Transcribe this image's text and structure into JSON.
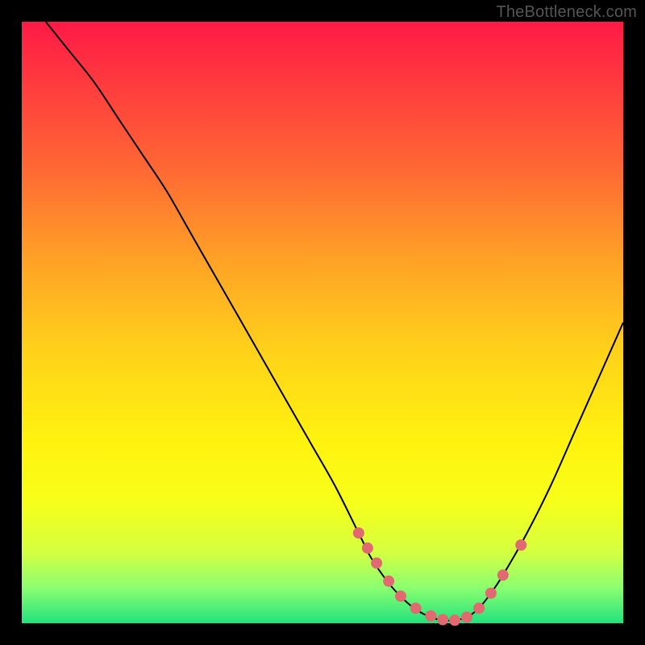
{
  "attribution": "TheBottleneck.com",
  "colors": {
    "background": "#000000",
    "gradient_top": "#ff1a46",
    "gradient_bottom": "#22e27e",
    "curve": "#000000",
    "marker": "#e06a6f"
  },
  "chart_data": {
    "type": "line",
    "title": "",
    "xlabel": "",
    "ylabel": "",
    "xlim": [
      0,
      100
    ],
    "ylim": [
      0,
      100
    ],
    "series": [
      {
        "name": "curve",
        "x": [
          4,
          8,
          12,
          16,
          20,
          24,
          28,
          32,
          36,
          40,
          44,
          48,
          52,
          56,
          57,
          58,
          60,
          62,
          64,
          66,
          68,
          70,
          72,
          74,
          76,
          78,
          80,
          84,
          88,
          92,
          96,
          100
        ],
        "y": [
          100,
          95,
          90,
          84,
          78,
          72,
          65,
          58,
          51,
          44,
          37,
          30,
          23,
          15,
          13,
          11,
          8,
          5.5,
          3.5,
          2,
          1,
          0.5,
          0.5,
          1,
          2.5,
          5,
          8,
          15,
          23,
          32,
          41,
          50
        ]
      }
    ],
    "markers": {
      "name": "highlight-points",
      "x": [
        56,
        57.5,
        59,
        61,
        63,
        65.5,
        68,
        70,
        72,
        74,
        76,
        78,
        80,
        83
      ],
      "y": [
        15,
        12.5,
        10,
        7,
        4.5,
        2.5,
        1.2,
        0.6,
        0.5,
        1,
        2.5,
        5,
        8,
        13
      ]
    }
  }
}
